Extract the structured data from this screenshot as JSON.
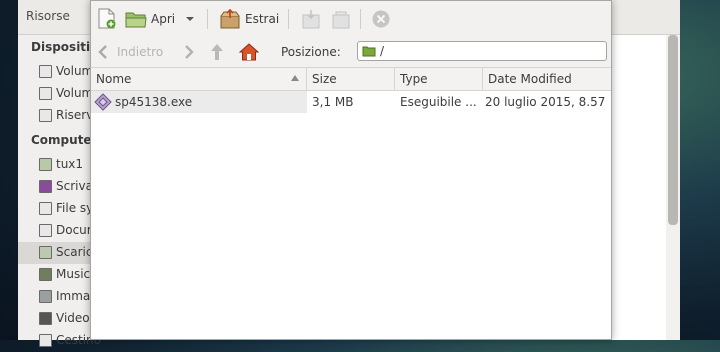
{
  "background_window": {
    "header_label": "Risorse",
    "sidebar": {
      "devices_heading": "Dispositivi",
      "computer_heading": "Computer",
      "devices": [
        "Volume",
        "Volume",
        "Riserva"
      ],
      "places": [
        "tux1",
        "Scrivania",
        "File system",
        "Documenti",
        "Scaricati",
        "Musica",
        "Immagini",
        "Video",
        "Cestino"
      ],
      "selected_place": "Scaricati"
    }
  },
  "toolbar": {
    "open_label": "Apri",
    "extract_label": "Estrai"
  },
  "location": {
    "back_label": "Indietro",
    "position_label": "Posizione:",
    "position_value": "/"
  },
  "columns": {
    "name": "Nome",
    "size": "Size",
    "type": "Type",
    "modified": "Date Modified"
  },
  "files": [
    {
      "name": "sp45138.exe",
      "size": "3,1 MB",
      "type": "Eseguibile ...",
      "modified": "20 luglio 2015,  8.57"
    }
  ],
  "colors": {
    "accent_home": "#d9522c",
    "folder_green": "#7aa83a",
    "selection": "#ebebeb"
  }
}
